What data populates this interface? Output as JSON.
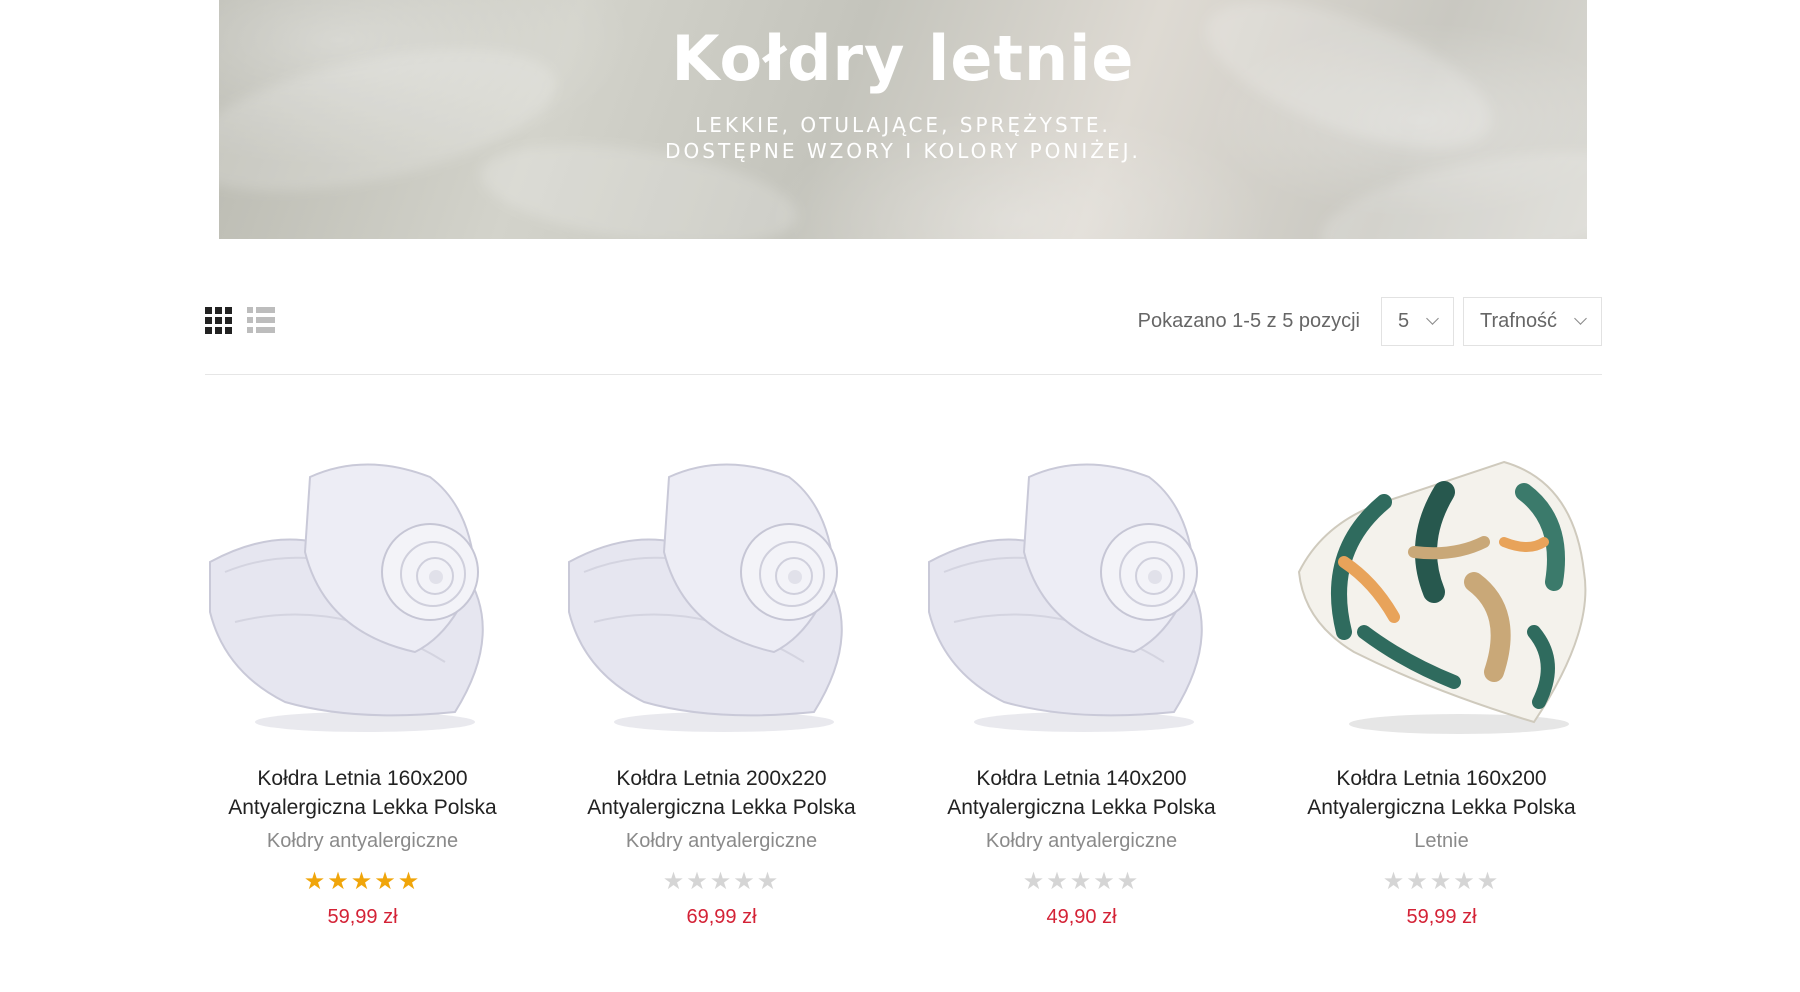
{
  "banner": {
    "title": "Kołdry letnie",
    "subtitle_line1": "LEKKIE, OTULAJĄCE, SPRĘŻYSTE.",
    "subtitle_line2": "DOSTĘPNE WZORY I KOLORY PONIŻEJ."
  },
  "toolbar": {
    "grid_icon": "grid-view-icon",
    "list_icon": "list-view-icon",
    "showing_text": "Pokazano 1-5 z 5 pozycji",
    "per_page_value": "5",
    "sort_value": "Trafność"
  },
  "products": [
    {
      "title_line1": "Kołdra Letnia 160x200",
      "title_line2": "Antyalergiczna Lekka Polska",
      "category": "Kołdry antyalergiczne",
      "rating": 5,
      "price": "59,99 zł",
      "image": "white-rolled-duvet"
    },
    {
      "title_line1": "Kołdra Letnia 200x220",
      "title_line2": "Antyalergiczna Lekka Polska",
      "category": "Kołdry antyalergiczne",
      "rating": 0,
      "price": "69,99 zł",
      "image": "white-rolled-duvet"
    },
    {
      "title_line1": "Kołdra Letnia 140x200",
      "title_line2": "Antyalergiczna Lekka Polska",
      "category": "Kołdry antyalergiczne",
      "rating": 0,
      "price": "49,90 zł",
      "image": "white-rolled-duvet"
    },
    {
      "title_line1": "Kołdra Letnia 160x200",
      "title_line2": "Antyalergiczna Lekka Polska",
      "category": "Letnie",
      "rating": 0,
      "price": "59,99 zł",
      "image": "leaf-pattern-rolled-duvet"
    }
  ],
  "colors": {
    "price": "#d42236",
    "star_on": "#f0a50a",
    "star_off": "#d5d5d5"
  }
}
